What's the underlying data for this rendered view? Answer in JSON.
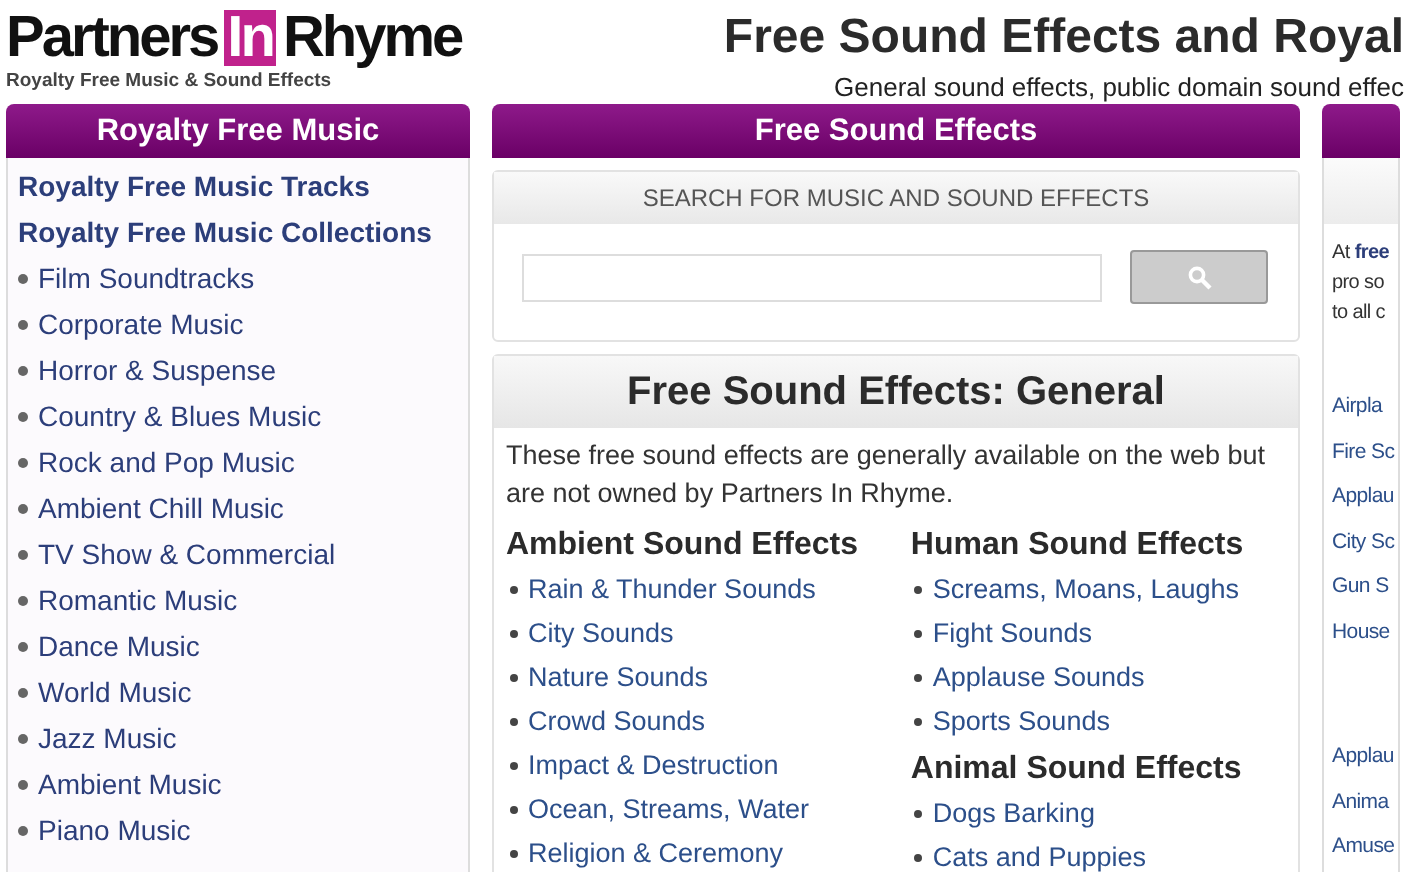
{
  "logo": {
    "part_1": "Partners",
    "part_2": "In",
    "part_3": "Rhyme",
    "tagline": "Royalty Free Music & Sound Effects"
  },
  "header": {
    "title": "Free Sound Effects and Royal",
    "subtitle": "General sound effects, public domain sound effec"
  },
  "sidebar": {
    "title": "Royalty Free Music",
    "links": [
      "Royalty Free Music Tracks",
      "Royalty Free Music Collections"
    ],
    "items": [
      "Film Soundtracks",
      "Corporate Music",
      "Horror & Suspense",
      "Country & Blues Music",
      "Rock and Pop Music",
      "Ambient Chill Music",
      "TV Show & Commercial",
      "Romantic Music",
      "Dance Music",
      "World Music",
      "Jazz Music",
      "Ambient Music",
      "Piano Music"
    ]
  },
  "main": {
    "title": "Free Sound Effects",
    "search": {
      "heading": "SEARCH FOR MUSIC AND SOUND EFFECTS"
    },
    "panel_title": "Free Sound Effects: General",
    "intro": "These free sound effects are generally available on the web but are not owned by Partners In Rhyme.",
    "columns": [
      [
        {
          "heading": "Ambient Sound Effects",
          "items": [
            "Rain & Thunder Sounds",
            "City Sounds",
            "Nature Sounds",
            "Crowd Sounds",
            "Impact & Destruction",
            "Ocean, Streams, Water",
            "Religion & Ceremony"
          ]
        }
      ],
      [
        {
          "heading": "Human Sound Effects",
          "items": [
            "Screams, Moans, Laughs",
            "Fight Sounds",
            "Applause Sounds",
            "Sports Sounds"
          ]
        },
        {
          "heading": "Animal Sound Effects",
          "items": [
            "Dogs Barking",
            "Cats and Puppies"
          ]
        }
      ]
    ]
  },
  "right": {
    "intro": "At **free**\npro so\nto all c",
    "links_1": [
      "Airpla",
      "Fire Sc",
      "Applau",
      "City Sc",
      "Gun S",
      "House"
    ],
    "links_2": [
      "Applau",
      "Anima",
      "Amuse"
    ]
  }
}
